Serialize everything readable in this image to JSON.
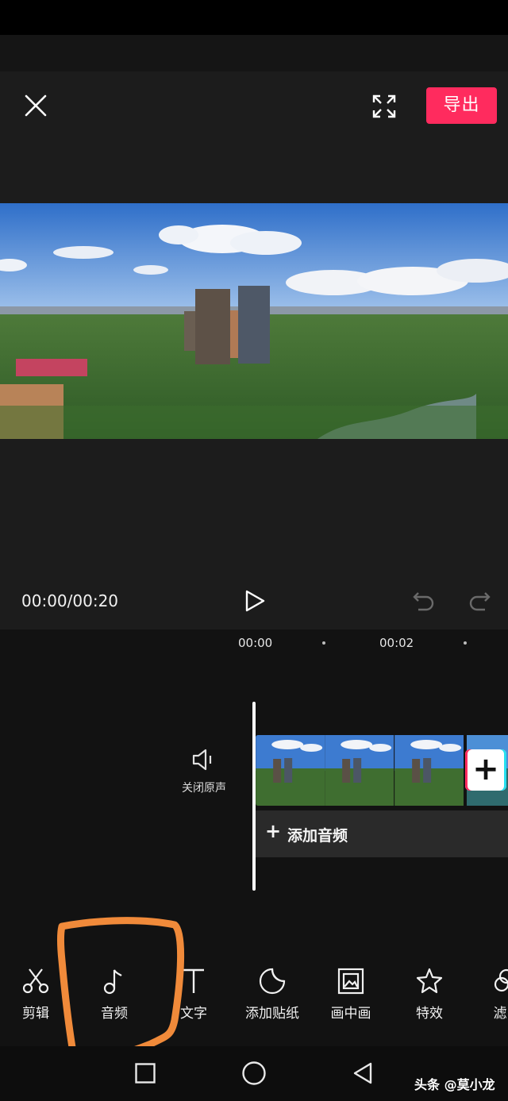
{
  "header": {
    "export_label": "导出"
  },
  "player": {
    "timecode": "00:00/00:20"
  },
  "timeline": {
    "ticks": [
      "00:00",
      "00:02"
    ],
    "mute_label": "关闭原声",
    "add_audio_label": "添加音频",
    "add_audio_plus": "+",
    "add_clip_plus": "+"
  },
  "toolbar": {
    "items": [
      {
        "label": "剪辑",
        "icon": "scissors-icon"
      },
      {
        "label": "音频",
        "icon": "music-note-icon"
      },
      {
        "label": "文字",
        "icon": "text-icon"
      },
      {
        "label": "添加贴纸",
        "icon": "sticker-icon"
      },
      {
        "label": "画中画",
        "icon": "picture-in-picture-icon"
      },
      {
        "label": "特效",
        "icon": "sparkle-icon"
      },
      {
        "label": "滤",
        "icon": "filter-icon"
      }
    ]
  },
  "watermark": "头条 @莫小龙",
  "colors": {
    "accent": "#ff2b5e",
    "annotation": "#f08a3a",
    "background": "#1c1c1c"
  }
}
